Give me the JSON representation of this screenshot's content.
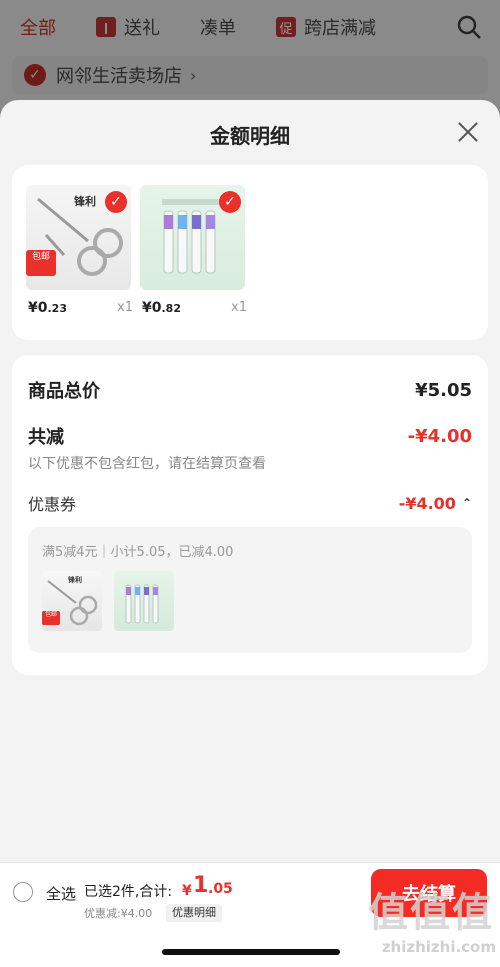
{
  "background": {
    "tabs": [
      {
        "label": "全部",
        "icon": "none"
      },
      {
        "label": "送礼",
        "icon": "gift-icon"
      },
      {
        "label": "凑单",
        "icon": "none"
      },
      {
        "label": "跨店满减",
        "icon": "promo-icon",
        "icon_text": "促"
      }
    ],
    "shop_name": "网邻生活卖场店"
  },
  "sheet": {
    "title": "金额明细",
    "products": [
      {
        "name": "scissors",
        "brand": "锋利",
        "tag": "包邮",
        "price_main": "¥0",
        "price_dec": ".23",
        "qty": "x1",
        "selected": true
      },
      {
        "name": "toothbrush",
        "price_main": "¥0",
        "price_dec": ".82",
        "qty": "x1",
        "selected": true
      }
    ],
    "summary": {
      "total_label": "商品总价",
      "total_value": "¥5.05",
      "reduce_label": "共减",
      "reduce_value": "-¥4.00",
      "note": "以下优惠不包含红包，请在结算页查看",
      "coupon_label": "优惠券",
      "coupon_value": "-¥4.00",
      "coupon_rule": "满5减4元｜小计5.05，已减4.00",
      "mini_brand": "锋利",
      "mini_tag": "包邮"
    }
  },
  "bottom": {
    "select_all": "全选",
    "selected": "已选2件,合计:",
    "sum_symbol": "¥",
    "sum_int": "1",
    "sum_dec": ".05",
    "discount": "优惠减:¥4.00",
    "detail_btn": "优惠明细",
    "checkout": "去结算"
  },
  "watermark": {
    "glyphs": "值值值",
    "url": "zhizhizhi.com"
  },
  "colors": {
    "accent": "#e9302b",
    "checkout": "#f42a25"
  }
}
